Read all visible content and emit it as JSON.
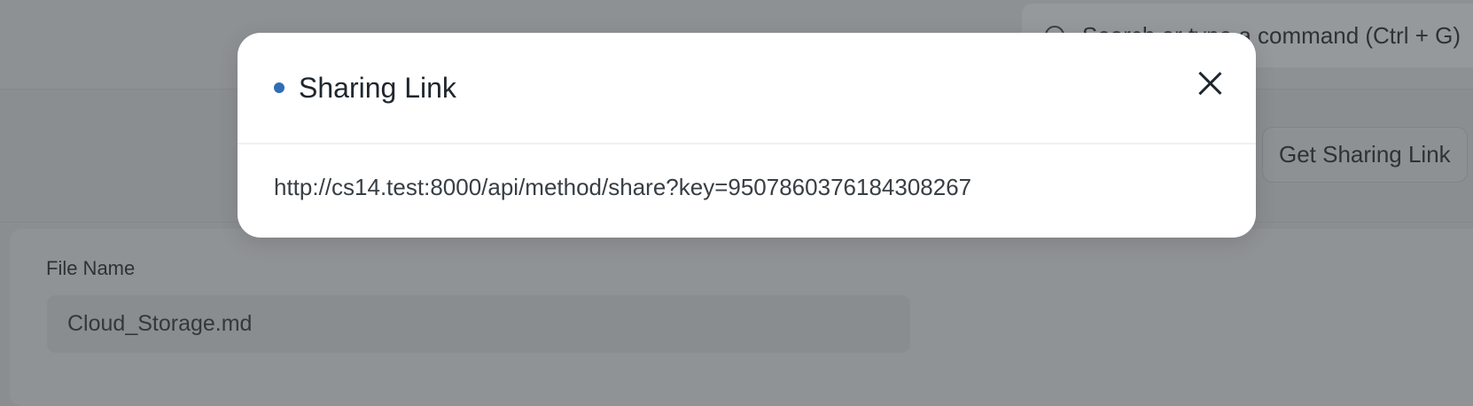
{
  "search": {
    "placeholder": "Search or type a command (Ctrl + G)"
  },
  "buttons": {
    "partial_label": "l",
    "get_sharing_link": "Get Sharing Link"
  },
  "form": {
    "file_name_label": "File Name",
    "file_name_value": "Cloud_Storage.md"
  },
  "modal": {
    "title": "Sharing Link",
    "url": "http://cs14.test:8000/api/method/share?key=9507860376184308267",
    "indicator_color": "#2f6db5"
  }
}
